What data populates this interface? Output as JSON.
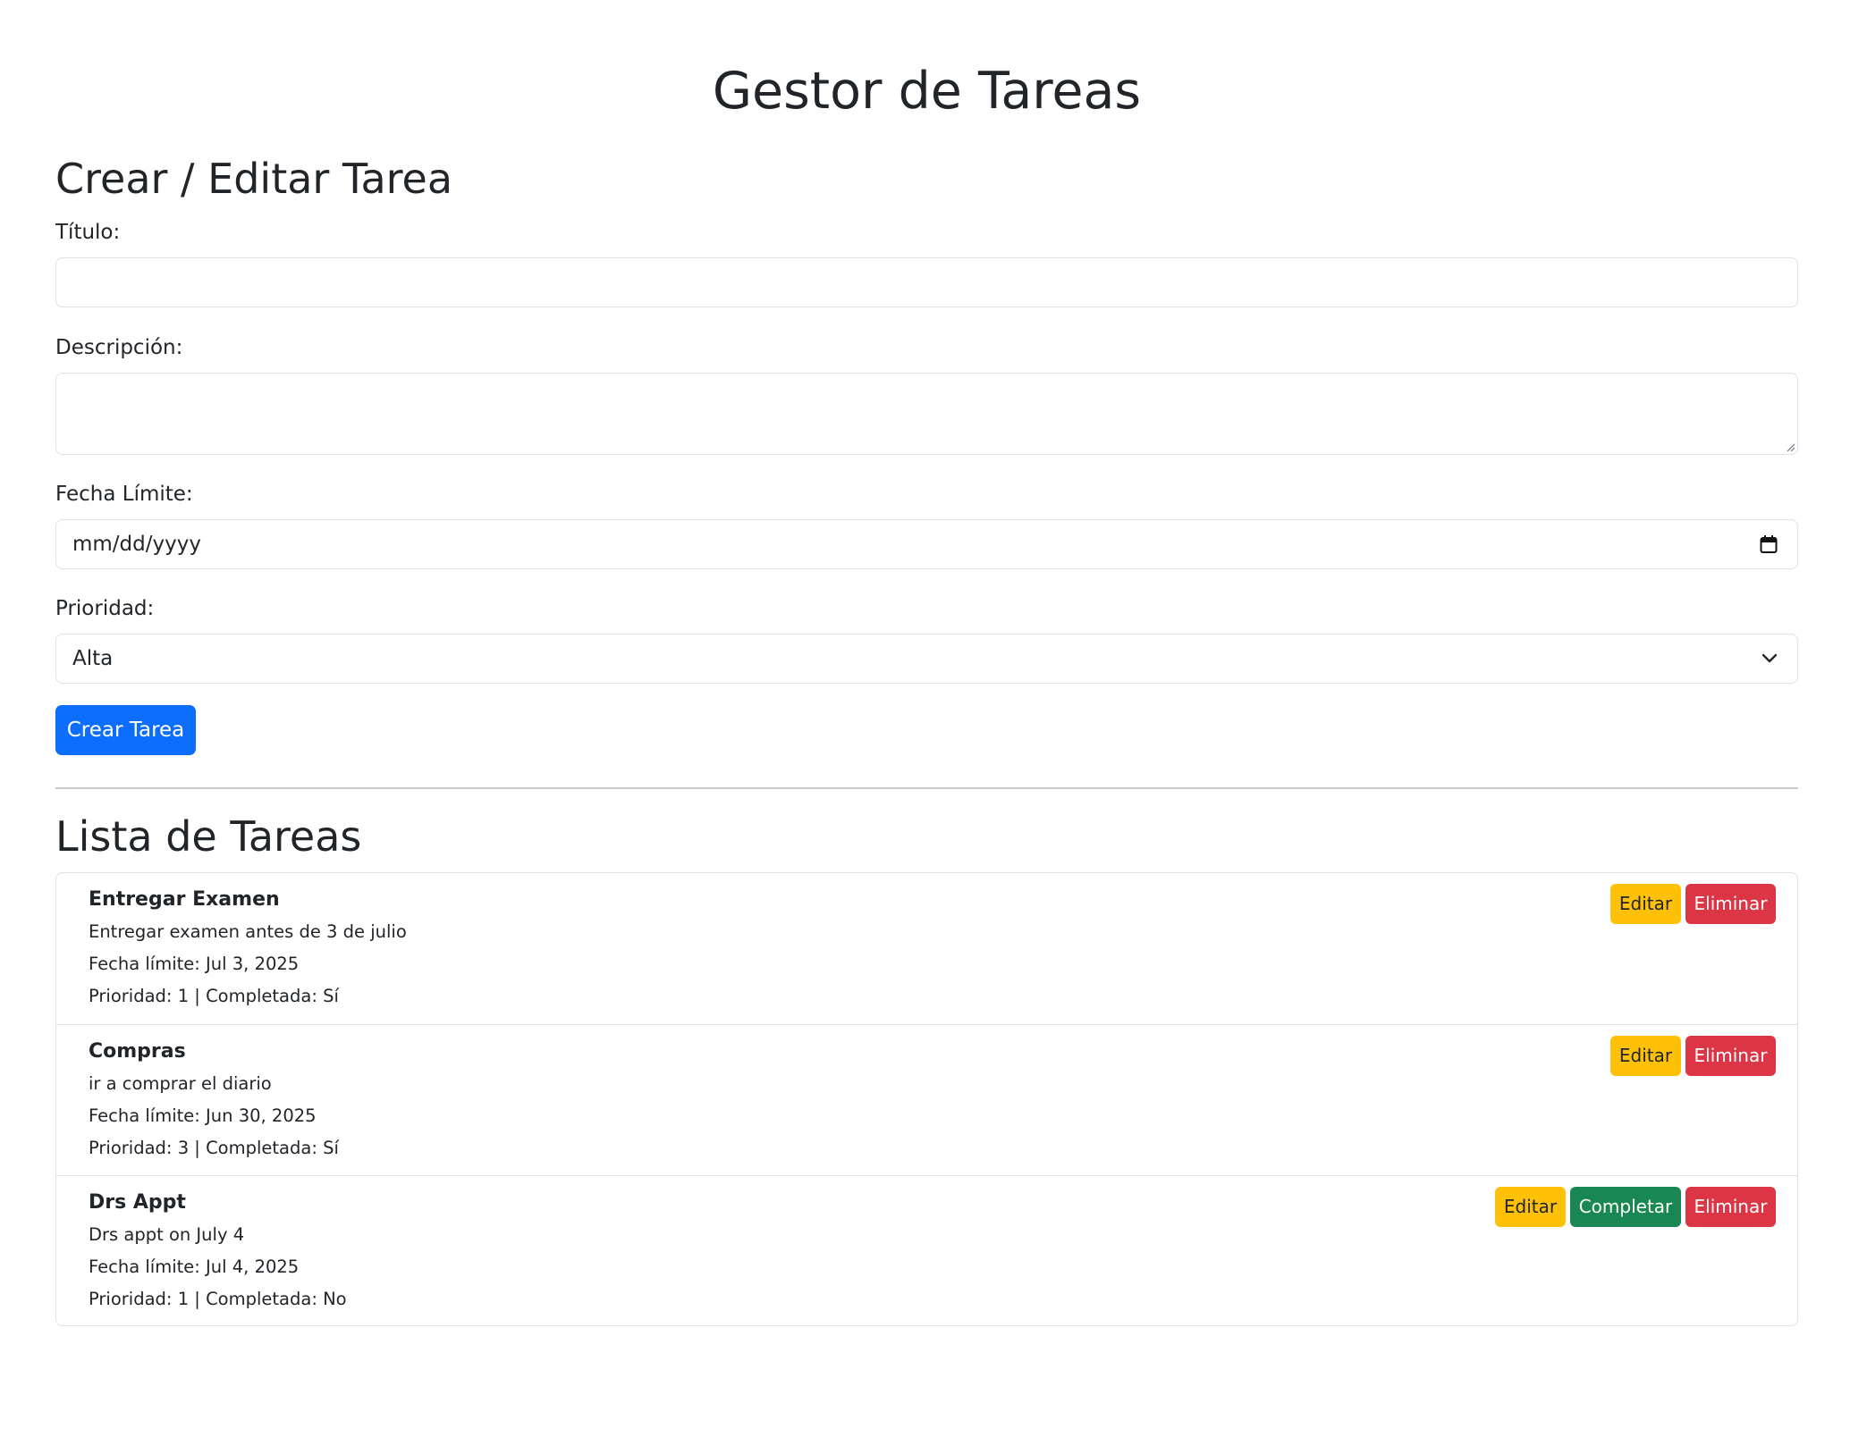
{
  "app": {
    "title": "Gestor de Tareas"
  },
  "form": {
    "heading": "Crear / Editar Tarea",
    "title_label": "Título:",
    "title_value": "",
    "description_label": "Descripción:",
    "description_value": "",
    "due_date_label": "Fecha Límite:",
    "due_date_placeholder": "mm/dd/yyyy",
    "priority_label": "Prioridad:",
    "priority_selected": "Alta",
    "submit_label": "Crear Tarea"
  },
  "list": {
    "heading": "Lista de Tareas",
    "tasks": [
      {
        "title": "Entregar Examen",
        "description": "Entregar examen antes de 3 de julio",
        "due": "Fecha límite: Jul 3, 2025",
        "meta": "Prioridad: 1 | Completada: Sí",
        "completed": true
      },
      {
        "title": "Compras",
        "description": "ir a comprar el diario",
        "due": "Fecha límite: Jun 30, 2025",
        "meta": "Prioridad: 3 | Completada: Sí",
        "completed": true
      },
      {
        "title": "Drs Appt",
        "description": "Drs appt on July 4",
        "due": "Fecha límite: Jul 4, 2025",
        "meta": "Prioridad: 1 | Completada: No",
        "completed": false
      }
    ],
    "actions": {
      "edit_label": "Editar",
      "complete_label": "Completar",
      "delete_label": "Eliminar"
    }
  },
  "colors": {
    "primary": "#0d6efd",
    "warning": "#ffc107",
    "success": "#198754",
    "danger": "#dc3545",
    "border": "#dee2e6",
    "text": "#212529"
  }
}
